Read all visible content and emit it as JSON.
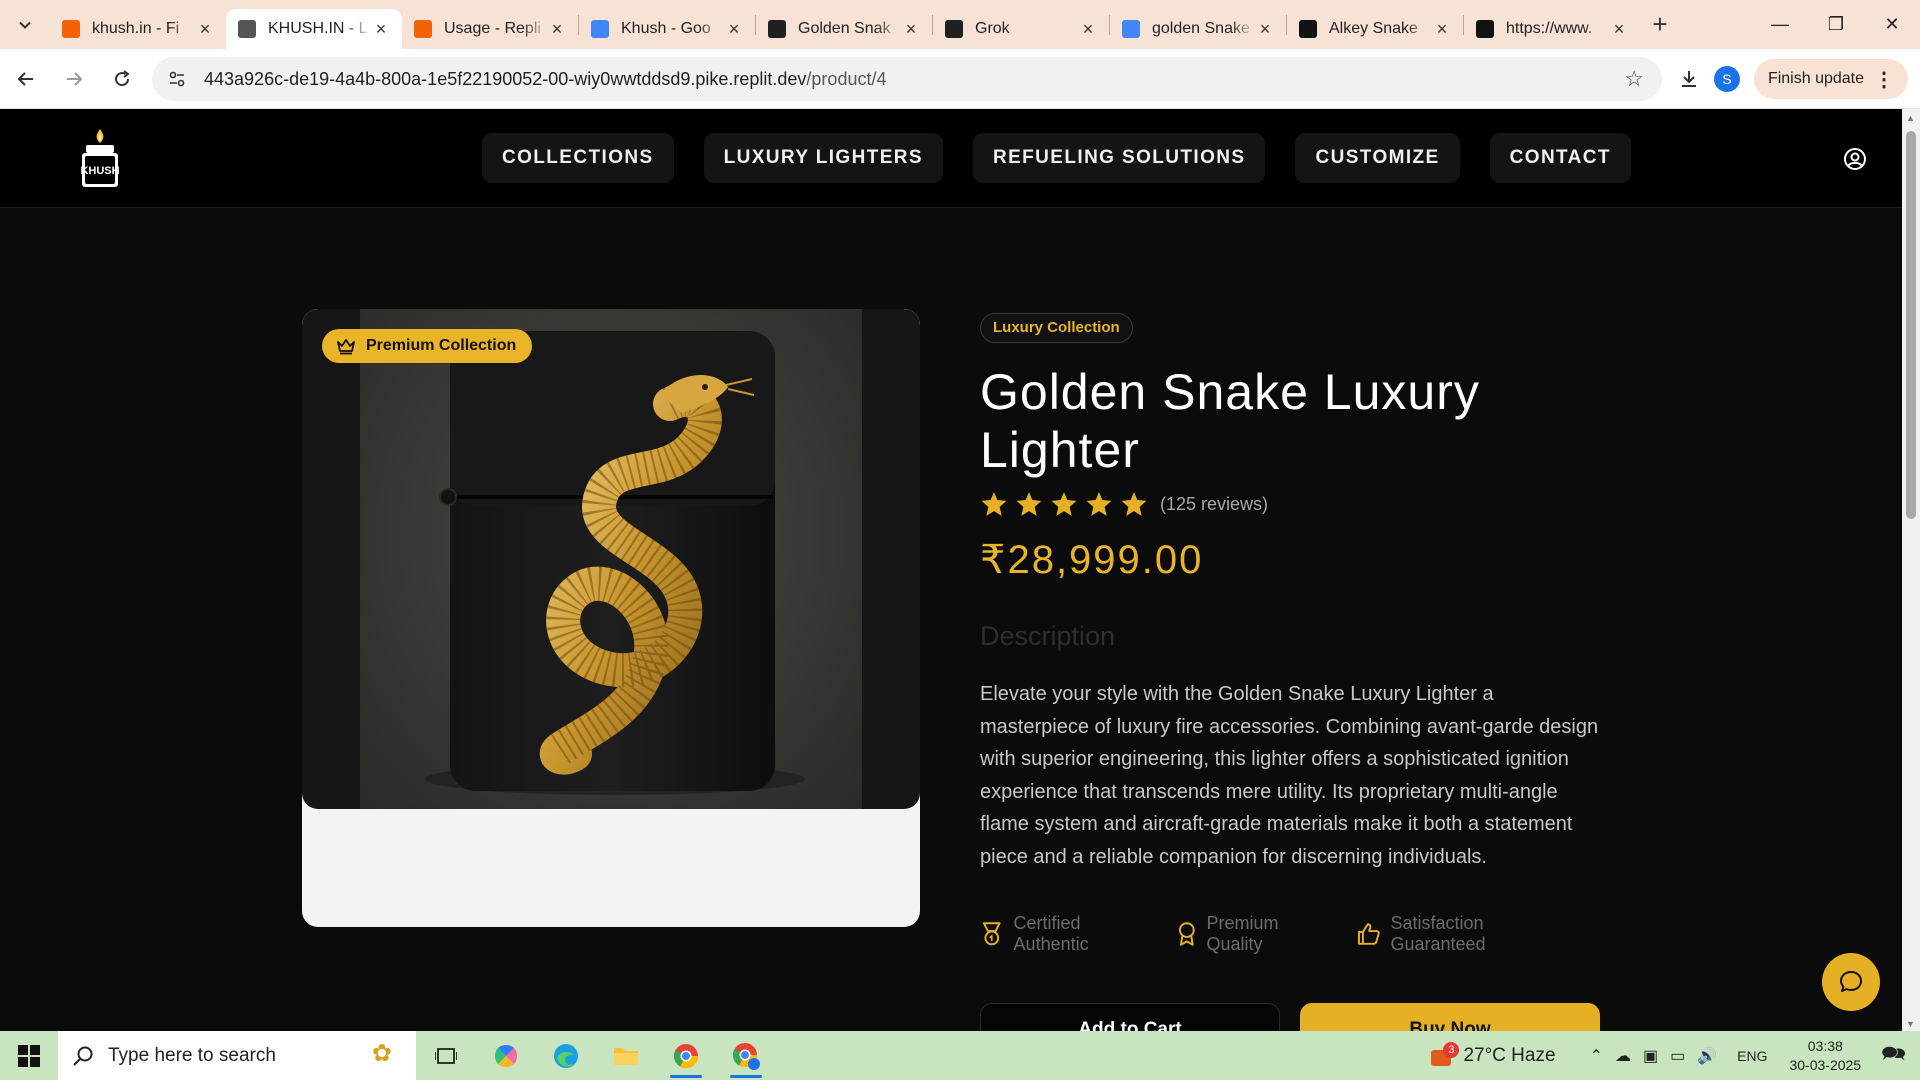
{
  "browser": {
    "tabs": [
      {
        "title": "khush.in - Fi",
        "icon": "replit-icon",
        "color": "#f26207"
      },
      {
        "title": "KHUSH.IN - L",
        "icon": "globe-icon",
        "color": "#555555"
      },
      {
        "title": "Usage - Repli",
        "icon": "replit-icon",
        "color": "#f26207"
      },
      {
        "title": "Khush - Goo",
        "icon": "docs-icon",
        "color": "#4285f4"
      },
      {
        "title": "Golden Snak",
        "icon": "chatgpt-icon",
        "color": "#202020"
      },
      {
        "title": "Grok",
        "icon": "grok-icon",
        "color": "#202020"
      },
      {
        "title": "golden Snake",
        "icon": "google-icon",
        "color": "#4285f4"
      },
      {
        "title": "Alkey Snake",
        "icon": "amazon-icon",
        "color": "#111111"
      },
      {
        "title": "https://www.",
        "icon": "site-icon",
        "color": "#111111"
      }
    ],
    "url_main": "443a926c-de19-4a4b-800a-1e5f22190052-00-wiy0wwtddsd9.pike.replit.dev",
    "url_path": "/product/4",
    "avatar_letter": "S",
    "finish_update": "Finish update"
  },
  "site": {
    "logo_text": "KHUSH",
    "nav": [
      "COLLECTIONS",
      "LUXURY LIGHTERS",
      "REFUELING SOLUTIONS",
      "CUSTOMIZE",
      "CONTACT"
    ]
  },
  "product": {
    "badge": "Premium Collection",
    "collection_tag": "Luxury Collection",
    "title": "Golden Snake Luxury Lighter",
    "rating": 5,
    "reviews": "(125 reviews)",
    "price": "₹28,999.00",
    "description_heading": "Description",
    "description": "Elevate your style with the Golden Snake Luxury Lighter a masterpiece of luxury fire accessories. Combining avant-garde design with superior engineering, this lighter offers a sophisticated ignition experience that transcends mere utility. Its proprietary multi-angle flame system and aircraft-grade materials make it both a statement piece and a reliable companion for discerning individuals.",
    "features": [
      "Certified Authentic",
      "Premium Quality",
      "Satisfaction Guaranteed"
    ],
    "add_to_cart": "Add to Cart",
    "buy_now": "Buy Now"
  },
  "colors": {
    "accent": "#e6b025",
    "background": "#0b0b0b"
  },
  "taskbar": {
    "search_placeholder": "Type here to search",
    "weather_badge": "3",
    "weather": "27°C  Haze",
    "lang": "ENG",
    "time": "03:38",
    "date": "30-03-2025"
  }
}
